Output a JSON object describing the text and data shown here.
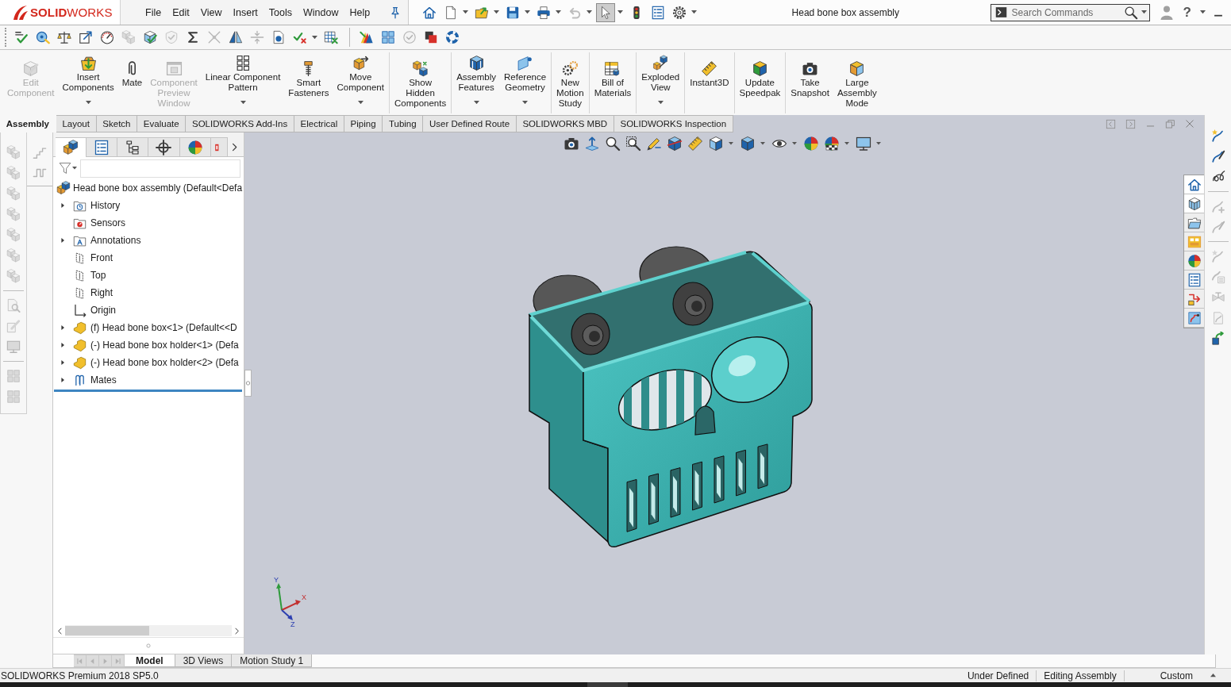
{
  "app": {
    "logo": "**SOLID**WORKS",
    "menu": [
      "File",
      "Edit",
      "View",
      "Insert",
      "Tools",
      "Window",
      "Help"
    ],
    "title": "Head bone box assembly",
    "search": {
      "placeholder": "Search Commands"
    },
    "help": "?"
  },
  "quick_access": [
    {
      "kind": "house",
      "dropdown": false,
      "disabled": false,
      "selected": false
    },
    {
      "kind": "page",
      "dropdown": true,
      "disabled": false,
      "selected": false
    },
    {
      "kind": "folder-arrow",
      "dropdown": true,
      "disabled": false,
      "selected": false
    },
    {
      "kind": "floppy",
      "dropdown": true,
      "disabled": false,
      "selected": false
    },
    {
      "kind": "printer",
      "dropdown": true,
      "disabled": false,
      "selected": false
    },
    {
      "kind": "undo-arrow",
      "dropdown": true,
      "disabled": true,
      "selected": false
    },
    {
      "kind": "cursor",
      "dropdown": true,
      "disabled": false,
      "selected": true
    },
    {
      "kind": "traffic-light",
      "dropdown": false,
      "disabled": false,
      "selected": false
    },
    {
      "kind": "list",
      "dropdown": false,
      "disabled": false,
      "selected": false
    },
    {
      "kind": "gear",
      "dropdown": true,
      "disabled": false,
      "selected": false
    }
  ],
  "standard_toolbar": [
    [
      {
        "kind": "lines-check",
        "dropdown": false,
        "disabled": false
      },
      {
        "kind": "tape",
        "dropdown": false,
        "disabled": false
      },
      {
        "kind": "balance",
        "dropdown": false,
        "disabled": false
      },
      {
        "kind": "arrow-box",
        "dropdown": false,
        "disabled": false
      },
      {
        "kind": "gauge",
        "dropdown": false,
        "disabled": false
      },
      {
        "kind": "cube-stack",
        "dropdown": false,
        "disabled": true
      },
      {
        "kind": "cube-check",
        "dropdown": false,
        "disabled": false
      },
      {
        "kind": "shield-check",
        "dropdown": false,
        "disabled": true
      },
      {
        "kind": "sigma",
        "dropdown": false,
        "disabled": false
      },
      {
        "kind": "cross-lines",
        "dropdown": false,
        "disabled": true
      },
      {
        "kind": "mirror",
        "dropdown": false,
        "disabled": false
      },
      {
        "kind": "arrows-in",
        "dropdown": false,
        "disabled": true
      },
      {
        "kind": "document",
        "dropdown": false,
        "disabled": false
      },
      {
        "kind": "check-cross",
        "dropdown": true,
        "disabled": false
      },
      {
        "kind": "table-cross",
        "dropdown": false,
        "disabled": false
      }
    ],
    [
      {
        "kind": "fan-arrow",
        "dropdown": false,
        "disabled": false
      },
      {
        "kind": "tiles",
        "dropdown": false,
        "disabled": false
      },
      {
        "kind": "circle-check",
        "dropdown": false,
        "disabled": true
      },
      {
        "kind": "overlap-squares",
        "dropdown": false,
        "disabled": false
      },
      {
        "kind": "lifebuoy",
        "dropdown": false,
        "disabled": false
      }
    ]
  ],
  "ribbon": [
    [
      {
        "label": "Edit\nComponent",
        "kind": "cube-pencil",
        "dropdown": false,
        "disabled": true
      },
      {
        "label": "Insert\nComponents",
        "kind": "basket-arrow",
        "dropdown": true,
        "disabled": false
      },
      {
        "label": "Mate",
        "kind": "paperclip",
        "dropdown": false,
        "disabled": false
      },
      {
        "label": "Component\nPreview\nWindow",
        "kind": "window",
        "dropdown": false,
        "disabled": true
      },
      {
        "label": "Linear Component\nPattern",
        "kind": "pattern-grid",
        "dropdown": true,
        "disabled": false
      },
      {
        "label": "Smart\nFasteners",
        "kind": "bolt",
        "dropdown": false,
        "disabled": false
      },
      {
        "label": "Move\nComponent",
        "kind": "cube-arrow",
        "dropdown": true,
        "disabled": false
      }
    ],
    [
      {
        "label": "Show\nHidden\nComponents",
        "kind": "boxes-show",
        "dropdown": false,
        "disabled": false
      }
    ],
    [
      {
        "label": "Assembly\nFeatures",
        "kind": "cube-ribbed",
        "dropdown": true,
        "disabled": false
      },
      {
        "label": "Reference\nGeometry",
        "kind": "plane-point",
        "dropdown": true,
        "disabled": false
      }
    ],
    [
      {
        "label": "New\nMotion\nStudy",
        "kind": "gears",
        "dropdown": false,
        "disabled": false
      }
    ],
    [
      {
        "label": "Bill of\nMaterials",
        "kind": "table-cube",
        "dropdown": false,
        "disabled": false
      }
    ],
    [
      {
        "label": "Exploded\nView",
        "kind": "boxes-explode",
        "dropdown": true,
        "disabled": false
      }
    ],
    [
      {
        "label": "Instant3D",
        "kind": "ruler",
        "dropdown": false,
        "disabled": false
      }
    ],
    [
      {
        "label": "Update\nSpeedpak",
        "kind": "cube",
        "dropdown": false,
        "disabled": false
      }
    ],
    [
      {
        "label": "Take\nSnapshot",
        "kind": "camera",
        "dropdown": false,
        "disabled": false
      },
      {
        "label": "Large\nAssembly\nMode",
        "kind": "box",
        "dropdown": false,
        "disabled": false
      }
    ]
  ],
  "tabs": [
    {
      "label": "Assembly",
      "selected": true
    },
    {
      "label": "Layout",
      "selected": false
    },
    {
      "label": "Sketch",
      "selected": false
    },
    {
      "label": "Evaluate",
      "selected": false
    },
    {
      "label": "SOLIDWORKS Add-Ins",
      "selected": false
    },
    {
      "label": "Electrical",
      "selected": false
    },
    {
      "label": "Piping",
      "selected": false
    },
    {
      "label": "Tubing",
      "selected": false
    },
    {
      "label": "User Defined Route",
      "selected": false
    },
    {
      "label": "SOLIDWORKS MBD",
      "selected": false
    },
    {
      "label": "SOLIDWORKS Inspection",
      "selected": false
    }
  ],
  "left_toolbar": [
    [
      {
        "kind": "cube-stack",
        "disabled": true
      },
      {
        "kind": "cube-stack",
        "disabled": true
      },
      {
        "kind": "cube-stack",
        "disabled": true
      },
      {
        "kind": "cube-stack",
        "disabled": true
      },
      {
        "kind": "cube-stack",
        "disabled": true
      },
      {
        "kind": "cube-stack",
        "disabled": true
      },
      {
        "kind": "cube-stack",
        "disabled": true
      }
    ],
    [
      {
        "kind": "magnifier-doc",
        "disabled": true
      },
      {
        "kind": "pencil-box",
        "disabled": true
      },
      {
        "kind": "monitor",
        "disabled": true
      }
    ],
    [
      {
        "kind": "tiles",
        "disabled": true
      },
      {
        "kind": "tiles",
        "disabled": true
      }
    ]
  ],
  "left_toolbar_2": [
    {
      "kind": "steps",
      "disabled": true
    },
    {
      "kind": "square-wave",
      "disabled": true
    }
  ],
  "feature_manager": {
    "tabs": [
      {
        "kind": "cubes-pair",
        "selected": true
      },
      {
        "kind": "list",
        "selected": false
      },
      {
        "kind": "config-tree",
        "selected": false
      },
      {
        "kind": "crosshair",
        "selected": false
      },
      {
        "kind": "color-ball",
        "selected": false
      },
      {
        "kind": "fragment",
        "selected": false
      }
    ],
    "tree": {
      "label": "Head bone box assembly (Default<Defa",
      "kind": "cubes-pair",
      "children": [
        {
          "label": "History",
          "kind": "history-folder",
          "collapsed": true
        },
        {
          "label": "Sensors",
          "kind": "sensor-folder",
          "collapsed": false
        },
        {
          "label": "Annotations",
          "kind": "annotation-folder",
          "collapsed": true
        },
        {
          "label": "Front",
          "kind": "plane",
          "collapsed": false
        },
        {
          "label": "Top",
          "kind": "plane",
          "collapsed": false
        },
        {
          "label": "Right",
          "kind": "plane",
          "collapsed": false
        },
        {
          "label": "Origin",
          "kind": "origin",
          "collapsed": false
        },
        {
          "label": "(f) Head bone box<1> (Default<<D",
          "kind": "block",
          "collapsed": true
        },
        {
          "label": "(-) Head bone box holder<1> (Defa",
          "kind": "block",
          "collapsed": true
        },
        {
          "label": "(-) Head bone box holder<2> (Defa",
          "kind": "block",
          "collapsed": true
        },
        {
          "label": "Mates",
          "kind": "paperclips",
          "collapsed": true
        }
      ]
    }
  },
  "viewport": {
    "triad": {
      "x": "X",
      "y": "Y",
      "z": "Z"
    }
  },
  "right_toolbar": [
    [
      {
        "kind": "route-star",
        "disabled": false
      },
      {
        "kind": "route-pen",
        "disabled": false
      },
      {
        "kind": "coil",
        "disabled": false
      }
    ],
    [
      {
        "kind": "route-plus",
        "disabled": true
      },
      {
        "kind": "route-pen",
        "disabled": true
      }
    ],
    [
      {
        "kind": "route-star",
        "disabled": true
      },
      {
        "kind": "route-list",
        "disabled": true
      },
      {
        "kind": "valve",
        "disabled": true
      },
      {
        "kind": "route-doc",
        "disabled": true
      },
      {
        "kind": "route-arrow",
        "disabled": false
      }
    ]
  ],
  "bottom_tabs": {
    "nav": [
      {
        "kind": "skip-left",
        "disabled": true
      },
      {
        "kind": "tri-left",
        "disabled": true
      },
      {
        "kind": "tri-right",
        "disabled": true
      },
      {
        "kind": "skip-right",
        "disabled": true
      }
    ],
    "tabs": [
      {
        "label": "Model",
        "selected": true
      },
      {
        "label": "3D Views",
        "selected": false
      },
      {
        "label": "Motion Study 1",
        "selected": false
      }
    ]
  },
  "status_bar": {
    "product": "SOLIDWORKS Premium 2018 SP5.0",
    "fields": [
      "Under Defined",
      "Editing Assembly",
      "Custom"
    ]
  }
}
